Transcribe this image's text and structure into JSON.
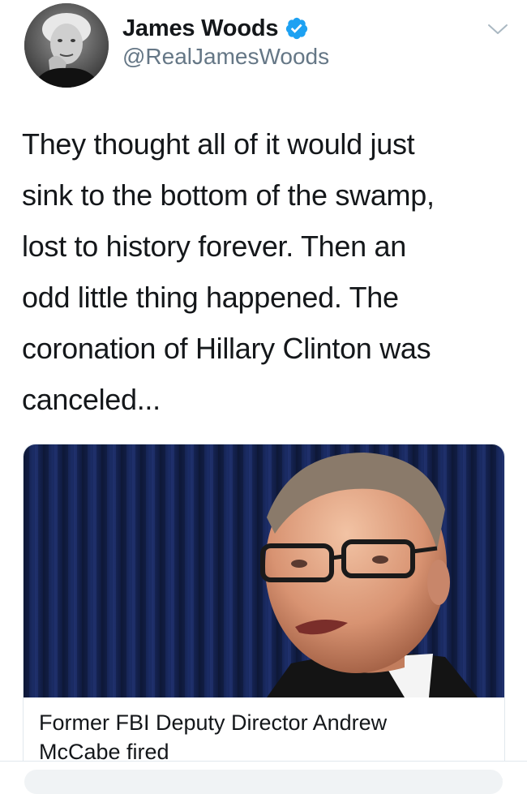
{
  "tweet": {
    "author": {
      "display_name": "James Woods",
      "handle": "@RealJamesWoods",
      "verified": true,
      "verified_color": "#1da1f2"
    },
    "text_lines": [
      "They thought all of it would just",
      "sink to the bottom of the swamp,",
      "lost to history forever. Then an",
      "odd little thing happened. The",
      "coronation of Hillary Clinton was",
      "canceled..."
    ],
    "card": {
      "title_lines": [
        "Former FBI Deputy Director Andrew",
        "McCabe fired"
      ]
    }
  },
  "icons": {
    "verified": "verified-badge-icon",
    "caret": "chevron-down-icon"
  },
  "colors": {
    "text": "#14171a",
    "secondary_text": "#657786",
    "border": "#e1e8ed"
  }
}
